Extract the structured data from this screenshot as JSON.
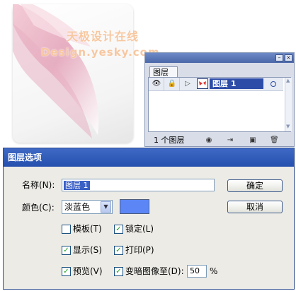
{
  "watermark": {
    "line1": "天极设计在线",
    "line2": "Design.yesky.com"
  },
  "layers_panel": {
    "tab_label": "图层",
    "minimize_glyph": "–",
    "close_glyph": "×",
    "layer": {
      "name": "图层 1",
      "eye_glyph": "👁",
      "lock_glyph": "🔒",
      "expand_glyph": "▷"
    },
    "footer_count": "1 个图层",
    "footer_icons": [
      "make-clipping-mask-icon",
      "create-sublayer-icon",
      "new-layer-icon",
      "trash-icon"
    ],
    "footer_glyphs": [
      "◉",
      "⇥",
      "▣",
      "🗑"
    ]
  },
  "dialog": {
    "title": "图层选项",
    "name_label": "名称(N):",
    "name_value": "图层 1",
    "color_label": "颜色(C):",
    "color_value": "淡蓝色",
    "swatch_color": "#5c86f5",
    "ok_label": "确定",
    "cancel_label": "取消",
    "checkboxes": [
      {
        "label": "模板(T)",
        "checked": false,
        "mark": ""
      },
      {
        "label": "锁定(L)",
        "checked": true,
        "mark": "✓"
      },
      {
        "label": "显示(S)",
        "checked": true,
        "mark": "✓"
      },
      {
        "label": "打印(P)",
        "checked": true,
        "mark": "✓"
      },
      {
        "label": "预览(V)",
        "checked": true,
        "mark": "✓"
      },
      {
        "label": "变暗图像至(D):",
        "checked": true,
        "mark": "✓"
      }
    ],
    "dim_value": "50",
    "dim_unit": "%"
  }
}
